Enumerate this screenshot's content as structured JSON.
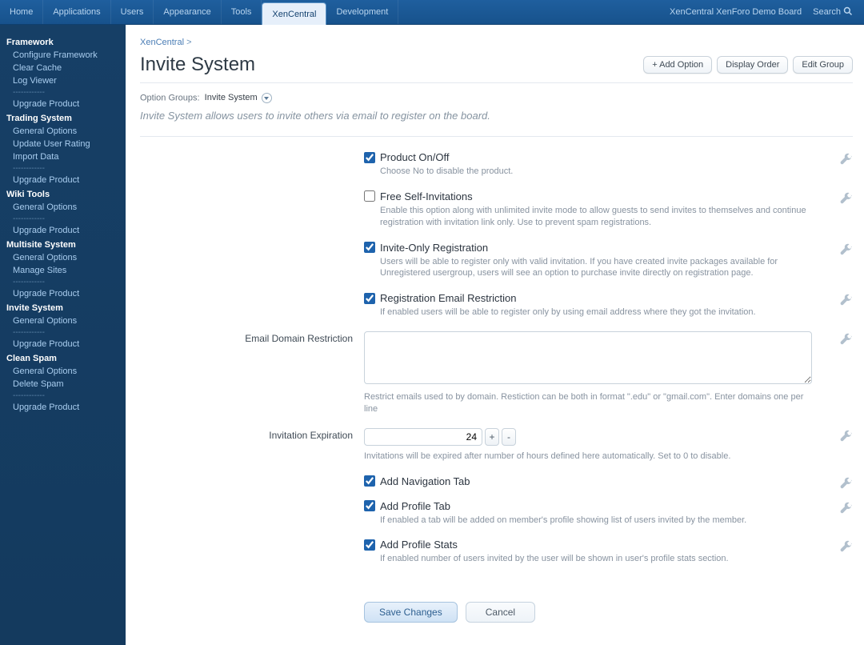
{
  "topnav": {
    "tabs": [
      "Home",
      "Applications",
      "Users",
      "Appearance",
      "Tools",
      "XenCentral",
      "Development"
    ],
    "active_index": 5,
    "brand": "XenCentral XenForo Demo Board",
    "search_label": "Search"
  },
  "sidebar": [
    {
      "title": "Framework",
      "items": [
        "Configure Framework",
        "Clear Cache",
        "Log Viewer"
      ],
      "after": [
        "Upgrade Product"
      ]
    },
    {
      "title": "Trading System",
      "items": [
        "General Options",
        "Update User Rating",
        "Import Data"
      ],
      "after": [
        "Upgrade Product"
      ]
    },
    {
      "title": "Wiki Tools",
      "items": [
        "General Options"
      ],
      "after": [
        "Upgrade Product"
      ]
    },
    {
      "title": "Multisite System",
      "items": [
        "General Options",
        "Manage Sites"
      ],
      "after": [
        "Upgrade Product"
      ]
    },
    {
      "title": "Invite System",
      "items": [
        "General Options"
      ],
      "after": [
        "Upgrade Product"
      ]
    },
    {
      "title": "Clean Spam",
      "items": [
        "General Options",
        "Delete Spam"
      ],
      "after": [
        "Upgrade Product"
      ]
    }
  ],
  "breadcrumb": {
    "root": "XenCentral",
    "sep": ">"
  },
  "page_title": "Invite System",
  "title_buttons": {
    "add_option": "+ Add Option",
    "display_order": "Display Order",
    "edit_group": "Edit Group"
  },
  "option_groups": {
    "label": "Option Groups:",
    "selected": "Invite System"
  },
  "intro": "Invite System allows users to invite others via email to register on the board.",
  "options": {
    "product_onoff": {
      "title": "Product On/Off",
      "desc": "Choose No to disable the product.",
      "checked": true
    },
    "free_self": {
      "title": "Free Self-Invitations",
      "desc": "Enable this option along with unlimited invite mode to allow guests to send invites to themselves and continue registration with invitation link only. Use to prevent spam registrations.",
      "checked": false
    },
    "invite_only": {
      "title": "Invite-Only Registration",
      "desc": "Users will be able to register only with valid invitation. If you have created invite packages available for Unregistered usergroup, users will see an option to purchase invite directly on registration page.",
      "checked": true
    },
    "reg_email_restriction": {
      "title": "Registration Email Restriction",
      "desc": "If enabled users will be able to register only by using email address where they got the invitation.",
      "checked": true
    },
    "email_domain": {
      "label": "Email Domain Restriction",
      "value": "",
      "hint": "Restrict emails used to by domain. Restiction can be both in format \".edu\" or \"gmail.com\". Enter domains one per line"
    },
    "invitation_expiration": {
      "label": "Invitation Expiration",
      "value": "24",
      "hint": "Invitations will be expired after number of hours defined here automatically. Set to 0 to disable."
    },
    "add_nav_tab": {
      "title": "Add Navigation Tab",
      "checked": true
    },
    "add_profile_tab": {
      "title": "Add Profile Tab",
      "desc": "If enabled a tab will be added on member's profile showing list of users invited by the member.",
      "checked": true
    },
    "add_profile_stats": {
      "title": "Add Profile Stats",
      "desc": "If enabled number of users invited by the user will be shown in user's profile stats section.",
      "checked": true
    }
  },
  "footer": {
    "save": "Save Changes",
    "cancel": "Cancel"
  },
  "divider_text": "------------"
}
